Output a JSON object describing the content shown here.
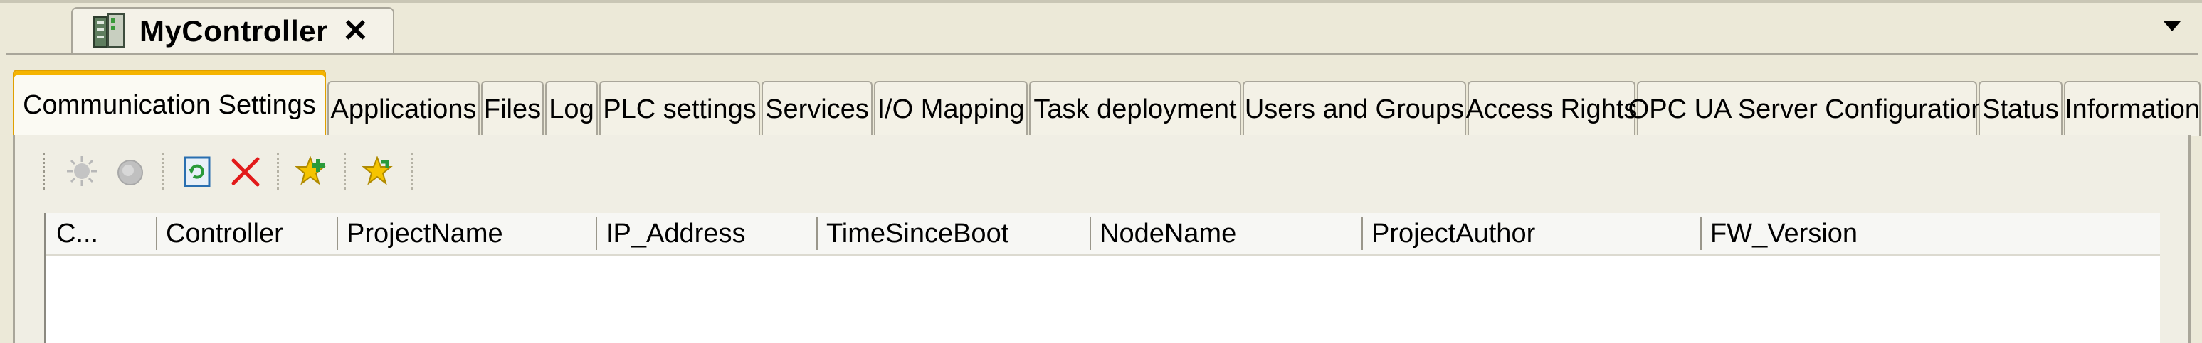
{
  "editor": {
    "title": "MyController",
    "close_glyph": "✕"
  },
  "tabs": [
    {
      "label": "Communication Settings",
      "active": true
    },
    {
      "label": "Applications",
      "active": false
    },
    {
      "label": "Files",
      "active": false
    },
    {
      "label": "Log",
      "active": false
    },
    {
      "label": "PLC settings",
      "active": false
    },
    {
      "label": "Services",
      "active": false
    },
    {
      "label": "I/O Mapping",
      "active": false
    },
    {
      "label": "Task deployment",
      "active": false
    },
    {
      "label": "Users and Groups",
      "active": false
    },
    {
      "label": "Access Rights",
      "active": false
    },
    {
      "label": "OPC UA Server Configuration",
      "active": false
    },
    {
      "label": "Status",
      "active": false
    },
    {
      "label": "Information",
      "active": false
    }
  ],
  "toolbar": {
    "icons": [
      "wink-icon",
      "gateway-icon",
      "refresh-icon",
      "remove-icon",
      "add-favorite-icon",
      "favorite-icon"
    ]
  },
  "table": {
    "columns": [
      "C...",
      "Controller",
      "ProjectName",
      "IP_Address",
      "TimeSinceBoot",
      "NodeName",
      "ProjectAuthor",
      "FW_Version"
    ],
    "rows": []
  },
  "colors": {
    "active_tab_accent": "#f5b400",
    "background": "#ece9d8"
  }
}
